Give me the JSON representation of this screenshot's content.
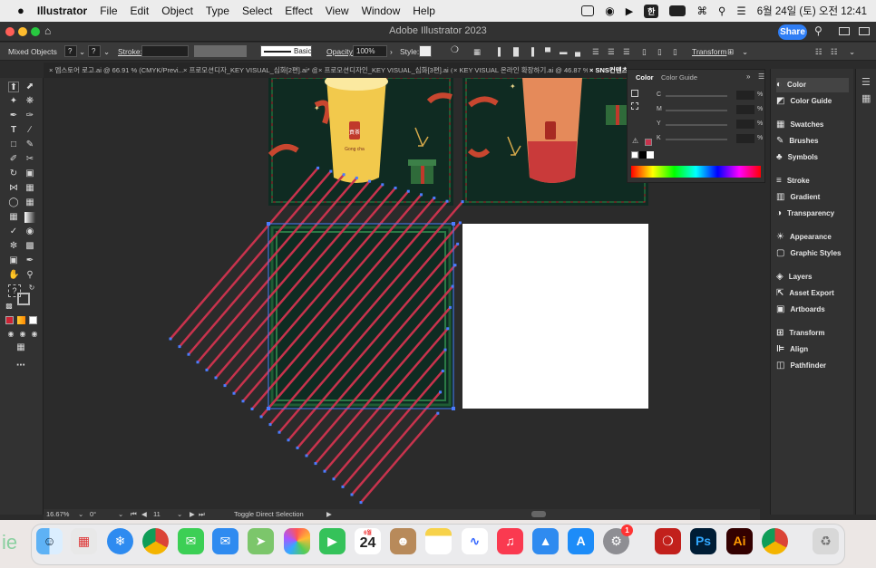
{
  "menubar": {
    "apple": "",
    "app": "Illustrator",
    "items": [
      "File",
      "Edit",
      "Object",
      "Type",
      "Select",
      "Effect",
      "View",
      "Window",
      "Help"
    ],
    "status_pill": "한",
    "battery_pill": "",
    "clock": "6월 24일 (토) 오전 12:41"
  },
  "window": {
    "title": "Adobe Illustrator 2023",
    "share_label": "Share"
  },
  "control": {
    "selection": "Mixed Objects",
    "stroke_label": "Stroke:",
    "stroke_profile": "Basic",
    "opacity_label": "Opacity:",
    "opacity_value": "100%",
    "style_label": "Style:",
    "transform_label": "Transform",
    "unknown1": "?",
    "unknown2": "?"
  },
  "tabs": [
    "엠스토어 로고.ai @ 66.91 % (CMYK/Previ...",
    "프로모션디자_KEY VISUAL_심화[2편].ai* @ ...",
    "프로모션디자인_KEY VISUAL_심화[3편].ai @...",
    "KEY VISUAL 온라인 확장하기.ai @ 46.87 %...",
    "SNS컨텐츠"
  ],
  "color_panel": {
    "tabs": [
      "Color",
      "Color Guide"
    ],
    "channels": [
      "C",
      "M",
      "Y",
      "K"
    ],
    "unit": "%"
  },
  "panels": [
    {
      "label": "Color",
      "icon": "color-icon"
    },
    {
      "label": "Color Guide",
      "icon": "color-guide-icon"
    },
    {
      "label": "Swatches",
      "icon": "swatches-icon"
    },
    {
      "label": "Brushes",
      "icon": "brushes-icon"
    },
    {
      "label": "Symbols",
      "icon": "symbols-icon"
    },
    {
      "label": "Stroke",
      "icon": "stroke-icon"
    },
    {
      "label": "Gradient",
      "icon": "gradient-icon"
    },
    {
      "label": "Transparency",
      "icon": "transparency-icon"
    },
    {
      "label": "Appearance",
      "icon": "appearance-icon"
    },
    {
      "label": "Graphic Styles",
      "icon": "graphic-styles-icon"
    },
    {
      "label": "Layers",
      "icon": "layers-icon"
    },
    {
      "label": "Asset Export",
      "icon": "asset-export-icon"
    },
    {
      "label": "Artboards",
      "icon": "artboards-icon"
    },
    {
      "label": "Transform",
      "icon": "transform-icon"
    },
    {
      "label": "Align",
      "icon": "align-icon"
    },
    {
      "label": "Pathfinder",
      "icon": "pathfinder-icon"
    }
  ],
  "status": {
    "zoom": "16.67%",
    "rotation": "0°",
    "artboard": "11",
    "tool_hint": "Toggle Direct Selection"
  },
  "artwork": {
    "cup_label": "貢茶",
    "brand": "Gong cha"
  },
  "dock": {
    "calendar_month": "6월",
    "calendar_day": "24",
    "settings_badge": "1",
    "ps_label": "Ps",
    "ai_label": "Ai",
    "partial_text": "ie"
  },
  "colors": {
    "accent": "#2f7ef5",
    "stripe": "#c8334d",
    "selection": "#4a7cff",
    "artboard_dark": "#0f2b22"
  }
}
